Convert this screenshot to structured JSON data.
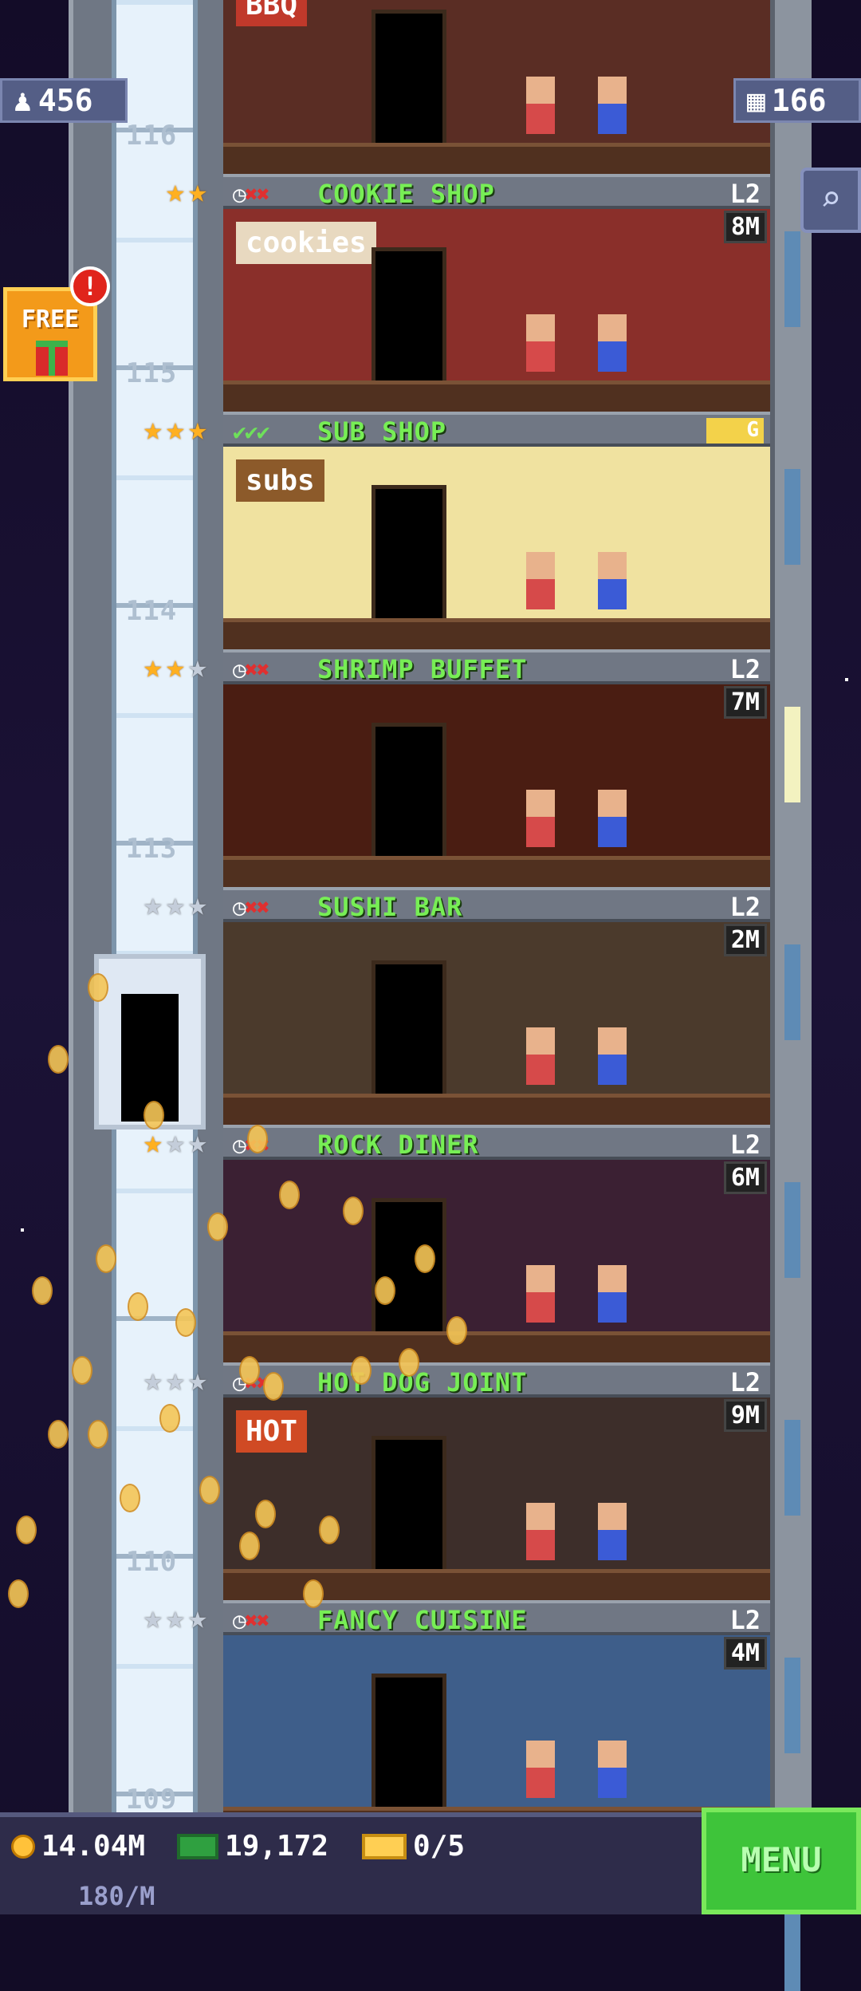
{
  "hud": {
    "population": "456",
    "floors": "166",
    "free_label": "FREE",
    "free_badge": "!"
  },
  "floors": [
    {
      "number": "116",
      "name": "",
      "level": "",
      "time": "",
      "stars_on": 0,
      "stars_off": 0,
      "status": "",
      "theme": "bbq",
      "sign": "BBQ"
    },
    {
      "number": "115",
      "name": "COOKIE SHOP",
      "level": "L2",
      "time": "8M",
      "stars_on": 2,
      "stars_off": 0,
      "status": "clock-x-x",
      "theme": "cookies",
      "sign": "cookies"
    },
    {
      "number": "114",
      "name": "SUB SHOP",
      "level": "",
      "time": "",
      "stars_on": 3,
      "stars_off": 0,
      "status": "check-check-check",
      "theme": "subs",
      "sign": "subs"
    },
    {
      "number": "113",
      "name": "SHRIMP BUFFET",
      "level": "L2",
      "time": "7M",
      "stars_on": 2,
      "stars_off": 1,
      "status": "clock-x-x",
      "theme": "shrimp",
      "sign": ""
    },
    {
      "number": "",
      "name": "SUSHI BAR",
      "level": "L2",
      "time": "2M",
      "stars_on": 0,
      "stars_off": 3,
      "status": "clock-x-x",
      "theme": "sushi",
      "sign": ""
    },
    {
      "number": "",
      "name": "ROCK DINER",
      "level": "L2",
      "time": "6M",
      "stars_on": 1,
      "stars_off": 2,
      "status": "clock-x-x",
      "theme": "rock",
      "sign": ""
    },
    {
      "number": "110",
      "name": "HOT DOG JOINT",
      "level": "L2",
      "time": "9M",
      "stars_on": 0,
      "stars_off": 3,
      "status": "clock-x-x",
      "theme": "hotdog",
      "sign": "HOT"
    },
    {
      "number": "109",
      "name": "FANCY CUISINE",
      "level": "L2",
      "time": "4M",
      "stars_on": 0,
      "stars_off": 3,
      "status": "clock-x-x",
      "theme": "fancy",
      "sign": ""
    }
  ],
  "special_badge": "G",
  "bottom": {
    "coins": "14.04M",
    "coin_rate": "180/M",
    "bux": "19,172",
    "tickets": "0/5",
    "menu_label": "MENU"
  },
  "colors": {
    "floor_name": "#77ee55",
    "star_on": "#ffb020",
    "star_off": "#c4cdda",
    "menu": "#3ec43a"
  }
}
